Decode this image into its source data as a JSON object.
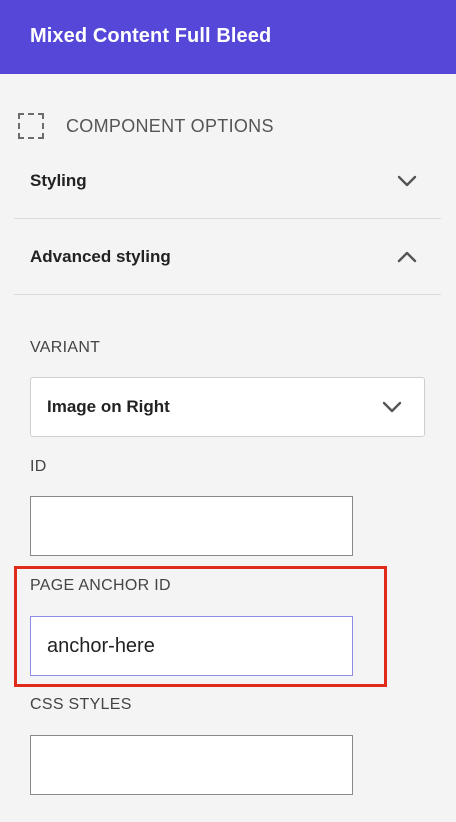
{
  "header": {
    "title": "Mixed Content Full Bleed"
  },
  "section": {
    "icon": "dashed-square-icon",
    "title": "COMPONENT OPTIONS"
  },
  "accordions": [
    {
      "label": "Styling",
      "state": "collapsed",
      "icon": "chevron-down-icon"
    },
    {
      "label": "Advanced styling",
      "state": "expanded",
      "icon": "chevron-up-icon"
    }
  ],
  "fields": {
    "variant": {
      "label": "VARIANT",
      "value": "Image on Right",
      "icon": "chevron-down-icon"
    },
    "id": {
      "label": "ID",
      "value": ""
    },
    "page_anchor_id": {
      "label": "PAGE ANCHOR ID",
      "value": "anchor-here",
      "highlighted": true
    },
    "css_styles": {
      "label": "CSS STYLES",
      "value": ""
    }
  },
  "colors": {
    "header_bg": "#5548d9",
    "page_bg": "#f4f4f4",
    "highlight": "#e02a1a",
    "focus_border": "#8f8ce6"
  }
}
